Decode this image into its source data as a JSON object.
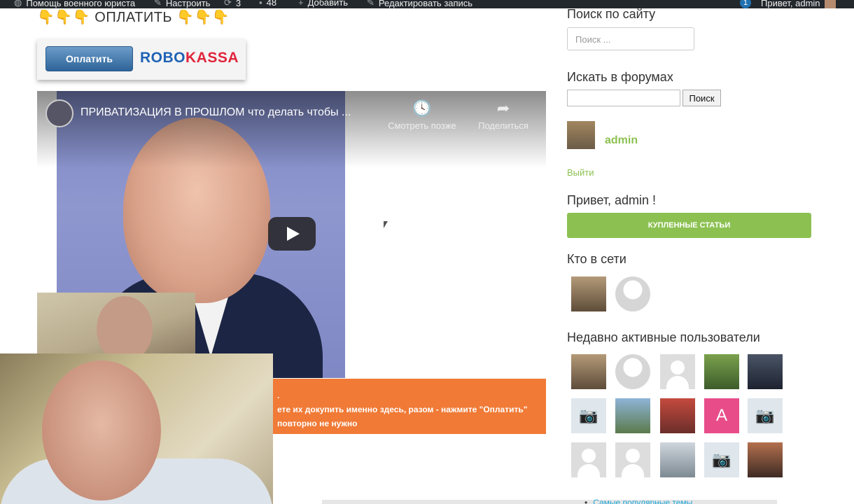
{
  "adminbar": {
    "site_name": "Помощь военного юриста",
    "customize": "Настроить",
    "updates": "3",
    "comments": "48",
    "new": "Добавить",
    "edit": "Редактировать запись",
    "notifications": "1",
    "greeting": "Привет, admin"
  },
  "content": {
    "pay_heading": "ОПЛАТИТЬ",
    "pay_heading_hands": "👇👇👇",
    "robo_button": "Оплатить",
    "robo_logo_a": "ROBO",
    "robo_logo_b": "KASSA",
    "video_title": "ПРИВАТИЗАЦИЯ В ПРОШЛОМ что делать чтобы ...",
    "watch_later": "Смотреть позже",
    "share": "Поделиться",
    "notice_line1": ".",
    "notice_line2": "ете их докупить именно здесь, разом - нажмите \"Оплатить\"",
    "notice_line3a": "повторно ",
    "notice_line3b": "не нужно",
    "popular_link": "Самые популярные темы"
  },
  "sidebar": {
    "site_search_heading": "Поиск по сайту",
    "site_search_placeholder": "Поиск ...",
    "forum_search_heading": "Искать в форумах",
    "forum_search_button": "Поиск",
    "user_name": "admin",
    "logout": "Выйти",
    "hello": "Привет, admin !",
    "bought_articles": "КУПЛЕННЫЕ СТАТЬИ",
    "online_heading": "Кто в сети",
    "recent_heading": "Недавно активные пользователи",
    "recent_letter_avatar": "A"
  },
  "colors": {
    "accent_green": "#8cc152",
    "notice_orange": "#f07a36",
    "adminbar_bg": "#23282d"
  }
}
